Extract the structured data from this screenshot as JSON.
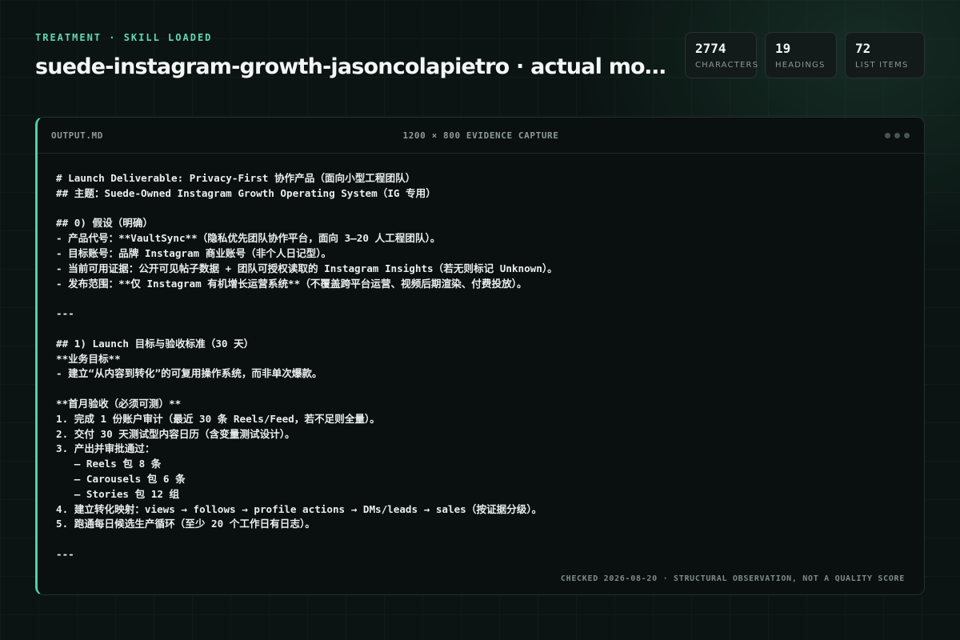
{
  "header": {
    "eyebrow": "TREATMENT · SKILL LOADED",
    "title": "suede-instagram-growth-jasoncolapietro · actual mode..."
  },
  "stats": [
    {
      "value": "2774",
      "label": "CHARACTERS"
    },
    {
      "value": "19",
      "label": "HEADINGS"
    },
    {
      "value": "72",
      "label": "LIST ITEMS"
    }
  ],
  "panel": {
    "filename": "OUTPUT.MD",
    "caption": "1200 × 800 EVIDENCE CAPTURE",
    "content": "# Launch Deliverable: Privacy-First 协作产品（面向小型工程团队）\n## 主题：Suede-Owned Instagram Growth Operating System（IG 专用）\n\n## 0) 假设（明确）\n- 产品代号：**VaultSync**（隐私优先团队协作平台，面向 3–20 人工程团队）。\n- 目标账号：品牌 Instagram 商业账号（非个人日记型）。\n- 当前可用证据：公开可见帖子数据 + 团队可授权读取的 Instagram Insights（若无则标记 Unknown）。\n- 发布范围：**仅 Instagram 有机增长运营系统**（不覆盖跨平台运营、视频后期渲染、付费投放）。\n\n---\n\n## 1) Launch 目标与验收标准（30 天）\n**业务目标**\n- 建立“从内容到转化”的可复用操作系统，而非单次爆款。\n\n**首月验收（必须可测）**\n1. 完成 1 份账户审计（最近 30 条 Reels/Feed，若不足则全量）。\n2. 交付 30 天测试型内容日历（含变量测试设计）。\n3. 产出并审批通过：\n   – Reels 包 8 条\n   – Carousels 包 6 条\n   – Stories 包 12 组\n4. 建立转化映射：views → follows → profile actions → DMs/leads → sales（按证据分级）。\n5. 跑通每日候选生产循环（至少 20 个工作日有日志）。\n\n---",
    "footer": "CHECKED 2026-08-20 · STRUCTURAL OBSERVATION, NOT A QUALITY SCORE"
  }
}
